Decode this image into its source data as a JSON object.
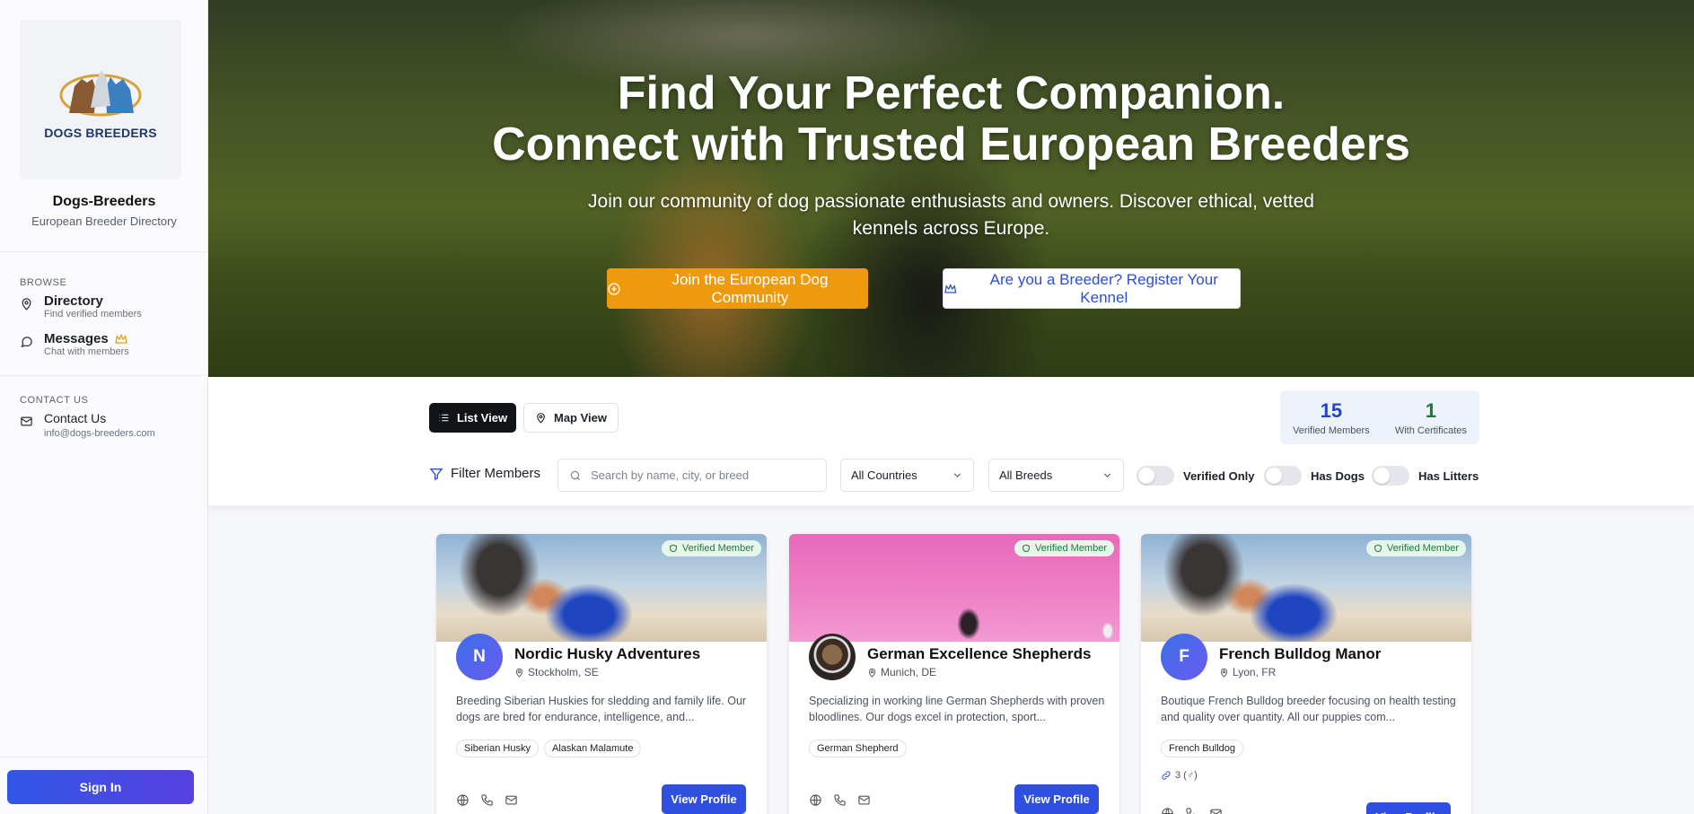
{
  "sidebar": {
    "logo_text": "DOGS BREEDERS",
    "brand_name": "Dogs-Breeders",
    "brand_sub": "European Breeder Directory",
    "browse_label": "BROWSE",
    "nav": [
      {
        "title": "Directory",
        "sub": "Find verified members",
        "icon": "map-pin-icon"
      },
      {
        "title": "Messages",
        "sub": "Chat with members",
        "icon": "chat-icon",
        "badge_icon": "crown-icon"
      }
    ],
    "contact_label": "CONTACT US",
    "contact": {
      "title": "Contact Us",
      "email": "info@dogs-breeders.com",
      "icon": "mail-icon"
    },
    "sign_in": "Sign In"
  },
  "hero": {
    "title_line1": "Find Your Perfect Companion.",
    "title_line2": "Connect with Trusted European Breeders",
    "subtitle": "Join our community of dog passionate enthusiasts and owners. Discover ethical, vetted kennels across Europe.",
    "join_button": "Join the European Dog Community",
    "breeder_button": "Are you a Breeder? Register Your Kennel"
  },
  "view": {
    "list_label": "List View",
    "map_label": "Map View"
  },
  "stats": [
    {
      "value": "15",
      "label": "Verified Members",
      "color": "#2346c4"
    },
    {
      "value": "1",
      "label": "With Certificates",
      "color": "#1a7a3a"
    }
  ],
  "filters": {
    "label": "Filter Members",
    "search_placeholder": "Search by name, city, or breed",
    "country": "All Countries",
    "breed": "All Breeds",
    "toggles": [
      "Verified Only",
      "Has Dogs",
      "Has Litters"
    ]
  },
  "cards": [
    {
      "badge": "Verified Member",
      "initial": "N",
      "name": "Nordic Husky Adventures",
      "location": "Stockholm, SE",
      "description": "Breeding Siberian Huskies for sledding and family life. Our dogs are bred for endurance, intelligence, and...",
      "tags": [
        "Siberian Husky",
        "Alaskan Malamute"
      ],
      "button": "View Profile"
    },
    {
      "badge": "Verified Member",
      "initial": "",
      "name": "German Excellence Shepherds",
      "location": "Munich, DE",
      "description": "Specializing in working line German Shepherds with proven bloodlines. Our dogs excel in protection, sport...",
      "tags": [
        "German Shepherd"
      ],
      "button": "View Profile"
    },
    {
      "badge": "Verified Member",
      "initial": "F",
      "name": "French Bulldog Manor",
      "location": "Lyon, FR",
      "description": "Boutique French Bulldog breeder focusing on health testing and quality over quantity. All our puppies com...",
      "tags": [
        "French Bulldog"
      ],
      "links": "3 (♂)",
      "button": "View Profile"
    }
  ]
}
